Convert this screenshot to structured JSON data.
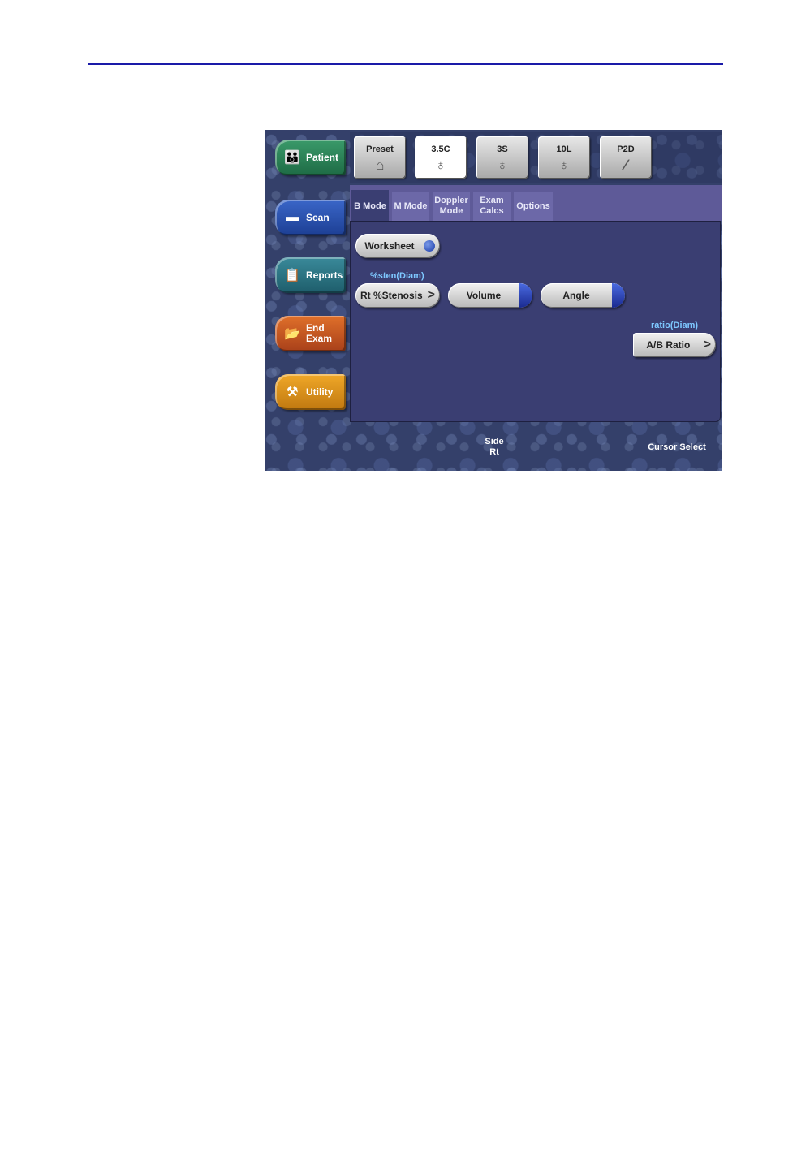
{
  "nav": {
    "patient": "Patient",
    "scan": "Scan",
    "reports": "Reports",
    "end_exam": "End\nExam",
    "utility": "Utility"
  },
  "probes": [
    {
      "label": "Preset",
      "icon": "preset-probe-icon"
    },
    {
      "label": "3.5C",
      "icon": "probe-icon",
      "active": true
    },
    {
      "label": "3S",
      "icon": "probe-icon"
    },
    {
      "label": "10L",
      "icon": "probe-icon"
    },
    {
      "label": "P2D",
      "icon": "pencil-probe-icon"
    }
  ],
  "tabs": [
    {
      "label": "B Mode",
      "active": true
    },
    {
      "label": "M Mode"
    },
    {
      "label": "Doppler\nMode"
    },
    {
      "label": "Exam\nCalcs"
    },
    {
      "label": "Options"
    }
  ],
  "content": {
    "worksheet": "Worksheet",
    "stenosis_group": "%sten(Diam)",
    "stenosis_button": "Rt %Stenosis",
    "volume": "Volume",
    "angle": "Angle",
    "ratio_group": "ratio(Diam)",
    "ratio_button": "A/B Ratio"
  },
  "status": {
    "side": "Side\nRt",
    "cursor_select": "Cursor Select"
  }
}
